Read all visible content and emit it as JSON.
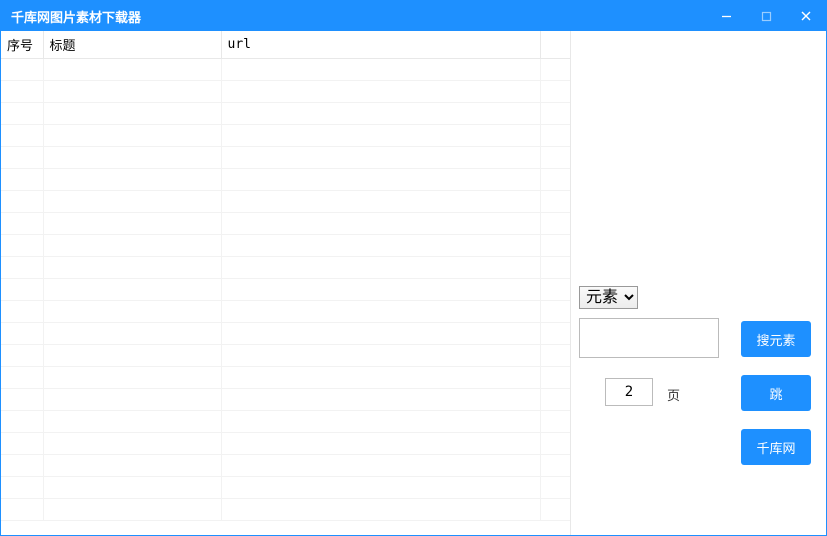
{
  "window": {
    "title": "千库网图片素材下载器"
  },
  "table": {
    "columns": {
      "index": "序号",
      "title": "标题",
      "url": "url"
    },
    "rows": []
  },
  "sidebar": {
    "category_selected": "元素",
    "search_value": "",
    "page_value": "2",
    "page_suffix": "页",
    "buttons": {
      "search": "搜元素",
      "jump": "跳",
      "site": "千库网"
    }
  }
}
